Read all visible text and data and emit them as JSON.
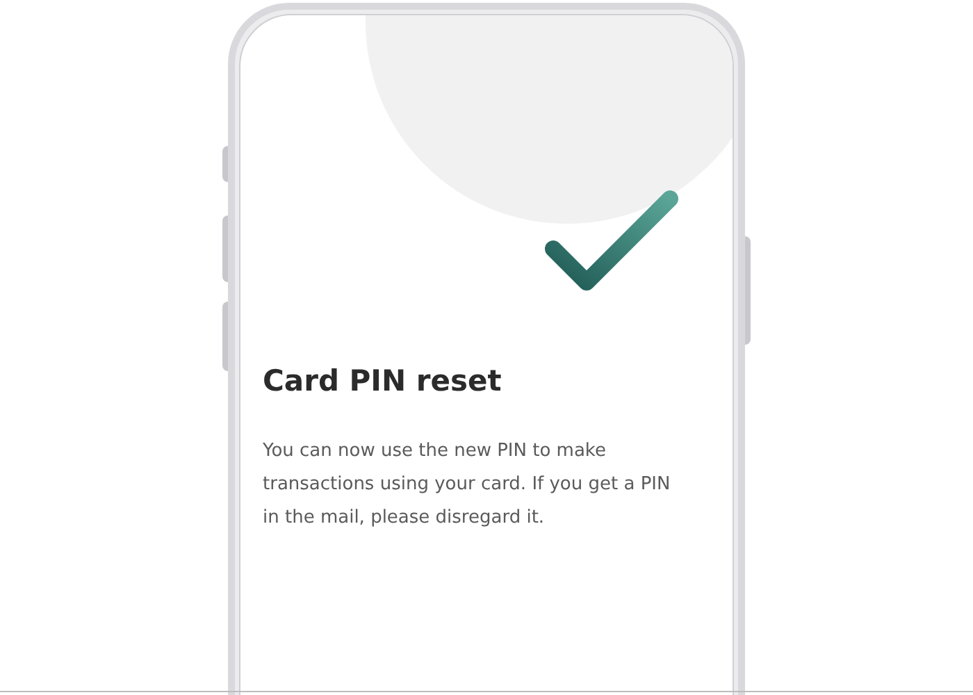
{
  "screen": {
    "title": "Card PIN reset",
    "message": "You can now use the new PIN to make transactions using your card. If you get a PIN in the mail, please disregard it."
  }
}
